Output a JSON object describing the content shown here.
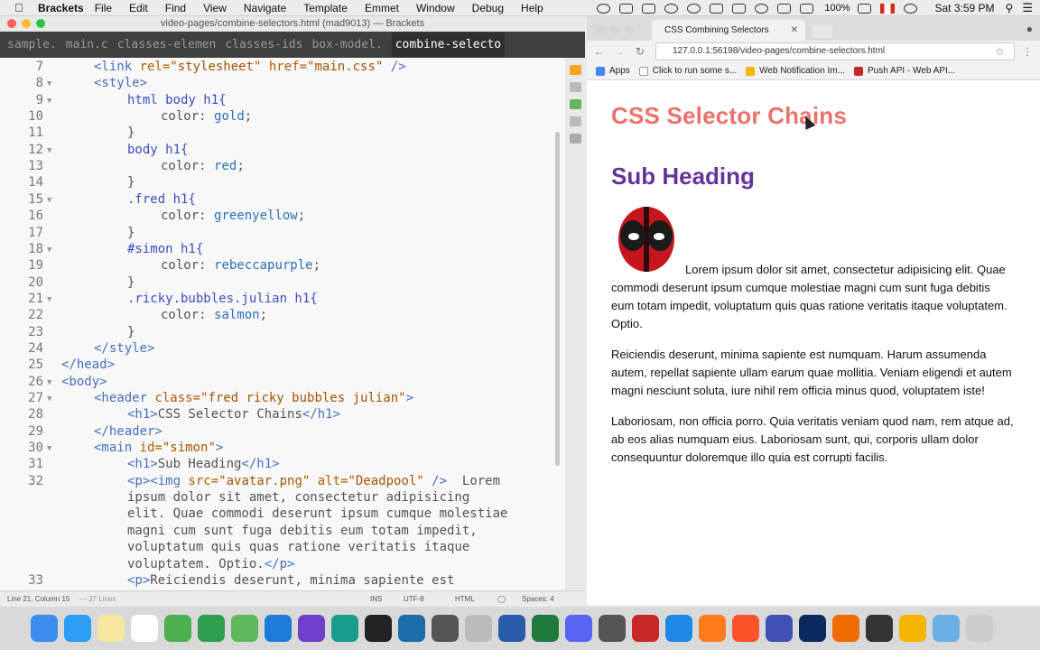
{
  "menubar": {
    "app": "Brackets",
    "items": [
      "File",
      "Edit",
      "Find",
      "View",
      "Navigate",
      "Template",
      "Emmet",
      "Window",
      "Debug",
      "Help"
    ],
    "battery": "100%",
    "clock": "Sat 3:59 PM"
  },
  "editor": {
    "window_title": "video-pages/combine-selectors.html (mad9013) — Brackets",
    "tabs": [
      "sample.",
      "main.c",
      "classes-elemen",
      "classes-ids",
      "box-model.",
      "combine-selecto"
    ],
    "lines": [
      {
        "n": "7",
        "fold": false,
        "indent": 104,
        "parts": [
          [
            "t",
            "<link "
          ],
          [
            "a",
            "rel="
          ],
          [
            "s",
            "\"stylesheet\" "
          ],
          [
            "a",
            "href="
          ],
          [
            "s",
            "\"main.css\" "
          ],
          [
            "t",
            "/>"
          ]
        ]
      },
      {
        "n": "8",
        "fold": true,
        "indent": 104,
        "parts": [
          [
            "t",
            "<style>"
          ]
        ]
      },
      {
        "n": "9",
        "fold": true,
        "indent": 141,
        "parts": [
          [
            "k",
            "html body h1{"
          ]
        ]
      },
      {
        "n": "10",
        "fold": false,
        "indent": 178,
        "parts": [
          [
            "p",
            "color: "
          ],
          [
            "v",
            "gold"
          ],
          [
            "p",
            ";"
          ]
        ]
      },
      {
        "n": "11",
        "fold": false,
        "indent": 141,
        "parts": [
          [
            "p",
            "}"
          ]
        ]
      },
      {
        "n": "12",
        "fold": true,
        "indent": 141,
        "parts": [
          [
            "k",
            "body h1{"
          ]
        ]
      },
      {
        "n": "13",
        "fold": false,
        "indent": 178,
        "parts": [
          [
            "p",
            "color: "
          ],
          [
            "v",
            "red"
          ],
          [
            "p",
            ";"
          ]
        ]
      },
      {
        "n": "14",
        "fold": false,
        "indent": 141,
        "parts": [
          [
            "p",
            "}"
          ]
        ]
      },
      {
        "n": "15",
        "fold": true,
        "indent": 141,
        "parts": [
          [
            "k",
            ".fred h1{"
          ]
        ]
      },
      {
        "n": "16",
        "fold": false,
        "indent": 178,
        "parts": [
          [
            "p",
            "color: "
          ],
          [
            "v",
            "greenyellow"
          ],
          [
            "p",
            ";"
          ]
        ]
      },
      {
        "n": "17",
        "fold": false,
        "indent": 141,
        "parts": [
          [
            "p",
            "}"
          ]
        ]
      },
      {
        "n": "18",
        "fold": true,
        "indent": 141,
        "parts": [
          [
            "k",
            "#simon h1{"
          ]
        ]
      },
      {
        "n": "19",
        "fold": false,
        "indent": 178,
        "parts": [
          [
            "p",
            "color: "
          ],
          [
            "v",
            "rebeccapurple"
          ],
          [
            "p",
            ";"
          ]
        ]
      },
      {
        "n": "20",
        "fold": false,
        "indent": 141,
        "parts": [
          [
            "p",
            "}"
          ]
        ]
      },
      {
        "n": "21",
        "fold": true,
        "indent": 141,
        "parts": [
          [
            "k",
            ".ricky.bubbles.julian h1{"
          ]
        ]
      },
      {
        "n": "22",
        "fold": false,
        "indent": 178,
        "parts": [
          [
            "p",
            "color: "
          ],
          [
            "v",
            "salmon"
          ],
          [
            "p",
            ";"
          ]
        ]
      },
      {
        "n": "23",
        "fold": false,
        "indent": 141,
        "parts": [
          [
            "p",
            "}"
          ]
        ]
      },
      {
        "n": "24",
        "fold": false,
        "indent": 104,
        "parts": [
          [
            "t",
            "</style>"
          ]
        ]
      },
      {
        "n": "25",
        "fold": false,
        "indent": 68,
        "parts": [
          [
            "t",
            "</head>"
          ]
        ]
      },
      {
        "n": "26",
        "fold": true,
        "indent": 68,
        "parts": [
          [
            "t",
            "<body>"
          ]
        ]
      },
      {
        "n": "27",
        "fold": true,
        "indent": 104,
        "parts": [
          [
            "t",
            "<header "
          ],
          [
            "a",
            "class="
          ],
          [
            "s",
            "\"fred ricky bubbles julian\""
          ],
          [
            "t",
            ">"
          ]
        ]
      },
      {
        "n": "28",
        "fold": false,
        "indent": 141,
        "parts": [
          [
            "t",
            "<h1>"
          ],
          [
            "p",
            "CSS Selector Chains"
          ],
          [
            "t",
            "</h1>"
          ]
        ]
      },
      {
        "n": "29",
        "fold": false,
        "indent": 104,
        "parts": [
          [
            "t",
            "</header>"
          ]
        ]
      },
      {
        "n": "30",
        "fold": true,
        "indent": 104,
        "parts": [
          [
            "t",
            "<main "
          ],
          [
            "a",
            "id="
          ],
          [
            "s",
            "\"simon\""
          ],
          [
            "t",
            ">"
          ]
        ]
      },
      {
        "n": "31",
        "fold": false,
        "indent": 141,
        "parts": [
          [
            "t",
            "<h1>"
          ],
          [
            "p",
            "Sub Heading"
          ],
          [
            "t",
            "</h1>"
          ]
        ]
      },
      {
        "n": "32",
        "fold": false,
        "indent": 141,
        "parts": [
          [
            "t",
            "<p><img "
          ],
          [
            "a",
            "src="
          ],
          [
            "s",
            "\"avatar.png\" "
          ],
          [
            "a",
            "alt="
          ],
          [
            "s",
            "\"Deadpool\" "
          ],
          [
            "t",
            "/>"
          ],
          [
            "p",
            "  Lorem"
          ]
        ]
      },
      {
        "n": "",
        "fold": false,
        "indent": 141,
        "parts": [
          [
            "p",
            "ipsum dolor sit amet, consectetur adipisicing"
          ]
        ]
      },
      {
        "n": "",
        "fold": false,
        "indent": 141,
        "parts": [
          [
            "p",
            "elit. Quae commodi deserunt ipsum cumque molestiae"
          ]
        ]
      },
      {
        "n": "",
        "fold": false,
        "indent": 141,
        "parts": [
          [
            "p",
            "magni cum sunt fuga debitis eum totam impedit,"
          ]
        ]
      },
      {
        "n": "",
        "fold": false,
        "indent": 141,
        "parts": [
          [
            "p",
            "voluptatum quis quas ratione veritatis itaque"
          ]
        ]
      },
      {
        "n": "",
        "fold": false,
        "indent": 141,
        "parts": [
          [
            "p",
            "voluptatem. Optio."
          ],
          [
            "t",
            "</p>"
          ]
        ]
      },
      {
        "n": "33",
        "fold": false,
        "indent": 141,
        "parts": [
          [
            "t",
            "<p>"
          ],
          [
            "p",
            "Reiciendis deserunt, minima sapiente est"
          ]
        ]
      }
    ],
    "status": {
      "position": "Line 21, Column 15",
      "lines": "— 37 Lines",
      "mode": "INS",
      "encoding": "UTF-8",
      "language": "HTML",
      "spaces": "Spaces: 4"
    }
  },
  "browser": {
    "tab_title": "CSS Combining Selectors",
    "url": "127.0.0.1:56198/video-pages/combine-selectors.html",
    "bookmarks": [
      "Apps",
      "Click to run some s...",
      "Web Notification Im...",
      "Push API - Web API..."
    ],
    "page": {
      "h1": "CSS Selector Chains",
      "h2": "Sub Heading",
      "img_alt": "Deadpool",
      "p1": "Lorem ipsum dolor sit amet, consectetur adipisicing elit. Quae commodi deserunt ipsum cumque molestiae magni cum sunt fuga debitis eum totam impedit, voluptatum quis quas ratione veritatis itaque voluptatem. Optio.",
      "p2": "Reiciendis deserunt, minima sapiente est numquam. Harum assumenda autem, repellat sapiente ullam earum quae mollitia. Veniam eligendi et autem magni nesciunt soluta, iure nihil rem officia minus quod, voluptatem iste!",
      "p3": "Laboriosam, non officia porro. Quia veritatis veniam quod nam, rem atque ad, ab eos alias numquam eius. Laboriosam sunt, qui, corporis ullam dolor consequuntur doloremque illo quia est corrupti facilis."
    }
  },
  "dock": {
    "apps": [
      {
        "name": "finder-icon",
        "color": "#3b8df0"
      },
      {
        "name": "app-store-icon",
        "color": "#2a9df4"
      },
      {
        "name": "notes-icon",
        "color": "#f5e6a0"
      },
      {
        "name": "calendar-icon",
        "color": "#ffffff"
      },
      {
        "name": "chrome-icon",
        "color": "#4caf50"
      },
      {
        "name": "leaf-icon",
        "color": "#2e9e4f"
      },
      {
        "name": "sourcetree-icon",
        "color": "#5fb85a"
      },
      {
        "name": "xcode-icon",
        "color": "#1d7bd8"
      },
      {
        "name": "github-icon",
        "color": "#6e40c9"
      },
      {
        "name": "gitkraken-icon",
        "color": "#1a9c8c"
      },
      {
        "name": "terminal-icon",
        "color": "#222222"
      },
      {
        "name": "brackets-icon",
        "color": "#1d6ea8"
      },
      {
        "name": "calculator-icon",
        "color": "#555555"
      },
      {
        "name": "sequel-icon",
        "color": "#bbbbbb"
      },
      {
        "name": "word-icon",
        "color": "#2b5caa"
      },
      {
        "name": "excel-icon",
        "color": "#1f7a3e"
      },
      {
        "name": "discord-icon",
        "color": "#5865f2"
      },
      {
        "name": "sublime-icon",
        "color": "#555555"
      },
      {
        "name": "filezilla-icon",
        "color": "#c62828"
      },
      {
        "name": "safari-icon",
        "color": "#1e88e5"
      },
      {
        "name": "firefox-icon",
        "color": "#ff7a1a"
      },
      {
        "name": "brave-icon",
        "color": "#fb542b"
      },
      {
        "name": "browser-icon",
        "color": "#3f51b5"
      },
      {
        "name": "photoshop-icon",
        "color": "#0a2a5e"
      },
      {
        "name": "pen-icon",
        "color": "#ef6c00"
      },
      {
        "name": "obs-icon",
        "color": "#333333"
      },
      {
        "name": "chrome-canary-icon",
        "color": "#f4b400"
      },
      {
        "name": "folder-icon",
        "color": "#6ab0e4"
      },
      {
        "name": "trash-icon",
        "color": "#cccccc"
      }
    ]
  }
}
